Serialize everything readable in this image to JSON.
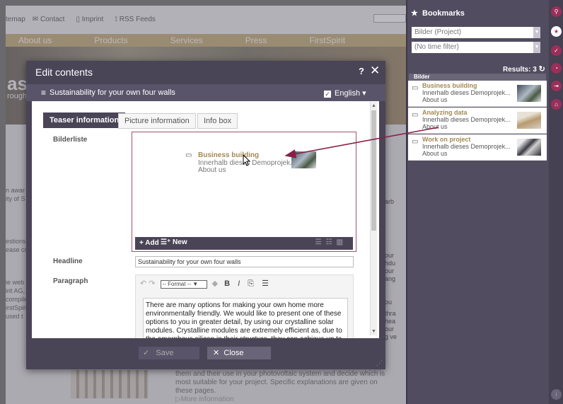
{
  "background": {
    "top_links": [
      "temap",
      "Contact",
      "Imprint",
      "RSS Feeds"
    ],
    "nav": [
      "About us",
      "Products",
      "Services",
      "Press",
      "FirstSpirit"
    ],
    "hero_text": "as",
    "hero_sub": "rough",
    "left_fragments": [
      {
        "text": "n awar"
      },
      {
        "text": "ity of S"
      },
      {
        "text": "estions"
      },
      {
        "text": "ease co"
      },
      {
        "text": "ie web"
      },
      {
        "text": "irit AG,"
      },
      {
        "text": "compile"
      },
      {
        "text": "irstSpiri"
      },
      {
        "text": "used t"
      }
    ],
    "right_fragments": [
      "arb",
      "our",
      "hdu",
      "our",
      "ang",
      "ou",
      "thra",
      "hea",
      "our",
      "g ve"
    ],
    "bottom_text": "them and their use in your photovoltaic system and decide which is most suitable for your project. Specific explanations are given on these pages.",
    "bottom_more": "More information"
  },
  "dialog": {
    "title": "Edit contents",
    "help": "?",
    "close": "✕",
    "subtitle": "Sustainability for your own four walls",
    "language": "English",
    "tabs": [
      "Teaser information",
      "Picture information",
      "Info box"
    ],
    "fields": {
      "bilderliste_label": "Bilderliste",
      "headline_label": "Headline",
      "headline_value": "Sustainability for your own four walls",
      "paragraph_label": "Paragraph",
      "format_select": "-- Format --",
      "paragraph_text": "There are many options for making your own home more environmentally friendly. We would like to present one of these options to you in greater detail, by using our crystalline solar modules. Crystalline modules are extremely efficient as, due to the amorphous silicon in their structure, they can achieve up to"
    },
    "list_item": {
      "title": "Business building",
      "sub": "Innerhalb dieses Demoprojek...",
      "sub2": "About us"
    },
    "list_footer": {
      "add": "Add",
      "new": "New"
    },
    "buttons": {
      "save": "Save",
      "close": "Close"
    }
  },
  "bookmarks": {
    "header": "Bookmarks",
    "filter1": "Bilder (Project)",
    "filter2": "(No time filter)",
    "results": "Results: 3",
    "group": "Bilder",
    "cards": [
      {
        "title": "Business building",
        "sub": "Innerhalb dieses Demoprojek...",
        "sub2": "About us"
      },
      {
        "title": "Analyzing data",
        "sub": "Innerhalb dieses Demoprojek...",
        "sub2": "About us"
      },
      {
        "title": "Work on project",
        "sub": "Innerhalb dieses Demoprojek...",
        "sub2": "About us"
      }
    ]
  },
  "icons": {
    "sidebar": [
      "search-icon",
      "star-icon",
      "check-icon",
      "clock-icon",
      "arrow-icon",
      "inbox-icon"
    ]
  },
  "colors": {
    "accent": "#9b2f5a",
    "dialog": "#4a4457",
    "gold": "#a38a55"
  }
}
